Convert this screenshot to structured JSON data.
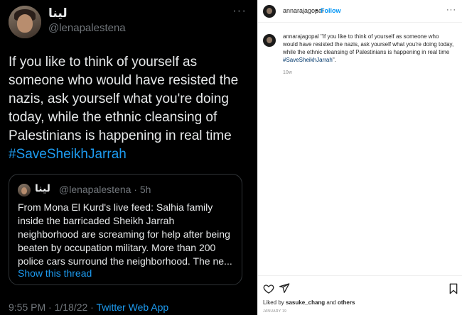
{
  "tweet": {
    "display_name": "لينا",
    "handle": "@lenapalestena",
    "more": "···",
    "text_lines": [
      "If you like to think of yourself as",
      "someone who would have resisted the",
      "nazis, ask yourself what you're doing",
      "today, while the ethnic cleansing of",
      "Palestinians is happening in real time"
    ],
    "hashtag": "#SaveSheikhJarrah",
    "quote": {
      "display_name": "لينا",
      "handle_time": "@lenapalestena · 5h",
      "text_lines": [
        "From Mona El Kurd's live feed: Salhia family",
        "inside the barricaded Sheikh Jarrah",
        "neighborhood are screaming for help after being",
        "beaten by occupation military. More than 200",
        "police cars surround the neighborhood. The ne..."
      ],
      "show_thread": "Show this thread"
    },
    "footer_time": "9:55 PM · 1/18/22 · ",
    "footer_source": "Twitter Web App"
  },
  "instagram": {
    "username": "annarajagopal",
    "dot": "•",
    "follow_label": "Follow",
    "more": "···",
    "caption_user": "annarajagopal",
    "caption_lines": [
      "\"If you like to think of yourself as someone who",
      "would have resisted the nazis, ask yourself what you're doing today,",
      "while the ethnic cleansing of Palestinians is happening in real time"
    ],
    "caption_tag": "#SaveSheikhJarrah",
    "caption_end": "\".",
    "time_ago": "10w",
    "liked_prefix": "Liked by ",
    "liked_user": "sasuke_chang",
    "liked_mid": " and ",
    "liked_others": "others",
    "date": "JANUARY 19"
  },
  "icons": {
    "heart": "heart-icon",
    "send": "send-icon",
    "save": "bookmark-icon"
  }
}
